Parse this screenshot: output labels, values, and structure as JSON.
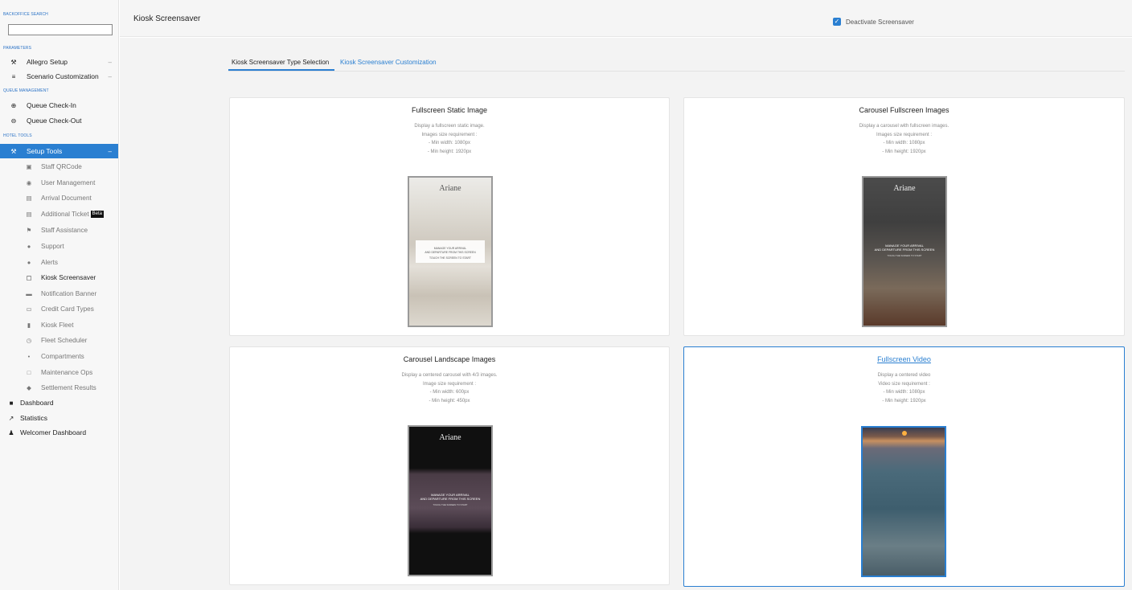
{
  "sidebar": {
    "backoffice_search_label": "BACKOFFICE SEARCH",
    "search_value": "",
    "sections": {
      "parameters": "PARAMETERS",
      "queue_management": "QUEUE MANAGEMENT",
      "hotel_tools": "HOTEL TOOLS"
    },
    "parameters_items": [
      {
        "label": "Allegro Setup",
        "icon": "wrench-icon"
      },
      {
        "label": "Scenario Customization",
        "icon": "hand-bell-icon"
      }
    ],
    "queue_items": [
      {
        "label": "Queue Check-In",
        "icon": "plus-circle-icon"
      },
      {
        "label": "Queue Check-Out",
        "icon": "minus-circle-icon"
      }
    ],
    "setup_tools": {
      "label": "Setup Tools",
      "icon": "wrench-icon"
    },
    "sub_items": [
      {
        "label": "Staff QRCode",
        "icon": "qrcode-icon"
      },
      {
        "label": "User Management",
        "icon": "user-circle-icon"
      },
      {
        "label": "Arrival Document",
        "icon": "document-icon"
      },
      {
        "label": "Additional Ticket",
        "icon": "document-icon",
        "badge": "Beta"
      },
      {
        "label": "Staff Assistance",
        "icon": "flag-icon"
      },
      {
        "label": "Support",
        "icon": "help-circle-icon"
      },
      {
        "label": "Alerts",
        "icon": "alert-icon"
      },
      {
        "label": "Kiosk Screensaver",
        "icon": "monitor-icon"
      },
      {
        "label": "Notification Banner",
        "icon": "banner-icon"
      },
      {
        "label": "Credit Card Types",
        "icon": "credit-card-icon"
      },
      {
        "label": "Kiosk Fleet",
        "icon": "fleet-icon"
      },
      {
        "label": "Fleet Scheduler",
        "icon": "clock-icon"
      },
      {
        "label": "Compartments",
        "icon": "key-icon"
      },
      {
        "label": "Maintenance Ops",
        "icon": "desktop-icon"
      },
      {
        "label": "Settlement Results",
        "icon": "settlement-icon"
      }
    ],
    "bottom_items": [
      {
        "label": "Dashboard",
        "icon": "dashboard-icon"
      },
      {
        "label": "Statistics",
        "icon": "trend-icon"
      },
      {
        "label": "Welcomer Dashboard",
        "icon": "welcomer-icon"
      }
    ]
  },
  "header": {
    "title": "Kiosk Screensaver",
    "deactivate_label": "Deactivate Screensaver",
    "deactivate_checked": true
  },
  "tabs": [
    {
      "label": "Kiosk Screensaver Type Selection",
      "active": true
    },
    {
      "label": "Kiosk Screensaver Customization",
      "active": false
    }
  ],
  "cards": [
    {
      "title": "Fullscreen Static Image",
      "lines": [
        "Display a fullscreen static image.",
        "Images size requirement :",
        "- Min width: 1080px",
        "- Min height: 1920px"
      ],
      "preview": {
        "logo": "Ariane",
        "text1": "MANAGE YOUR ARRIVAL",
        "text2": "AND DEPARTURE FROM THIS SCREEN",
        "text3": "TOUCH THE SCREEN TO START"
      },
      "selected": false
    },
    {
      "title": "Carousel Fullscreen Images",
      "lines": [
        "Display a carousel with fullscreen images.",
        "Images size requirement :",
        "- Min width: 1080px",
        "- Min height: 1920px"
      ],
      "preview": {
        "logo": "Ariane",
        "text1": "MANAGE YOUR ARRIVAL",
        "text2": "AND DEPARTURE FROM THIS SCREEN",
        "text3": "TOUCH THE SCREEN TO START"
      },
      "selected": false
    },
    {
      "title": "Carousel Landscape Images",
      "lines": [
        "Display a centered carousel with 4/3 images.",
        "Image size requirement :",
        "- Min width: 600px",
        "- Min height: 450px"
      ],
      "preview": {
        "logo": "Ariane",
        "text1": "MANAGE YOUR ARRIVAL",
        "text2": "AND DEPARTURE FROM THIS SCREEN",
        "text3": "TOUCH THE SCREEN TO START"
      },
      "selected": false
    },
    {
      "title": "Fullscreen Video",
      "lines": [
        "Display a centered video",
        "Video size requirement :",
        "- Min width: 1080px",
        "- Min height: 1920px"
      ],
      "selected": true
    }
  ]
}
